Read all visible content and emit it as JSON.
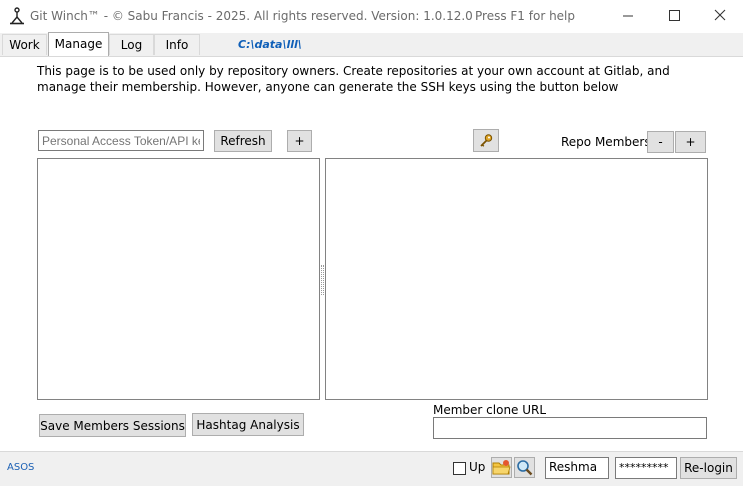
{
  "window": {
    "title": "Git Winch™  - © Sabu Francis - 2025. All rights reserved. Version: 1.0.12.0",
    "help_hint": "Press F1 for help"
  },
  "tabs": [
    {
      "label": "Work",
      "active": false
    },
    {
      "label": "Manage",
      "active": true
    },
    {
      "label": "Log",
      "active": false
    },
    {
      "label": "Info",
      "active": false
    }
  ],
  "path_label": "C:\\data\\lll\\",
  "description": "This page is to be used only by repository owners. Create repositories at your own account at Gitlab, and manage their membership. However, anyone can generate the SSH keys using the button below",
  "token_input": {
    "placeholder": "Personal Access Token/API key"
  },
  "buttons": {
    "refresh": "Refresh",
    "add_repo": "+",
    "remove_member": "-",
    "add_member": "+",
    "save_sessions": "Save Members Sessions",
    "hashtag": "Hashtag Analysis",
    "relogin": "Re-login"
  },
  "repo_members_label": "Repo Members",
  "member_clone_url_label": "Member clone URL",
  "member_clone_url_value": "",
  "status": {
    "link": "ASOS",
    "up_label": "Up",
    "up_checked": false,
    "username": "Reshma",
    "password_mask": "*********"
  },
  "icons": {
    "app": "winch-icon",
    "ssh_key": "key-icon",
    "open_folder": "folder-icon",
    "search": "magnifier-icon"
  }
}
